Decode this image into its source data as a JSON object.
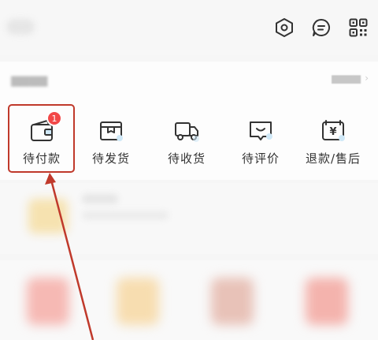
{
  "header": {
    "icons": [
      "settings-icon",
      "message-icon",
      "qrcode-icon"
    ]
  },
  "orders": {
    "items": [
      {
        "label": "待付款",
        "icon": "wallet-icon",
        "badge": "1"
      },
      {
        "label": "待发货",
        "icon": "box-icon"
      },
      {
        "label": "待收货",
        "icon": "truck-icon"
      },
      {
        "label": "待评价",
        "icon": "review-icon"
      },
      {
        "label": "退款/售后",
        "icon": "refund-icon"
      }
    ]
  },
  "colors": {
    "highlight": "#c0392b",
    "badge": "#f24848",
    "accent": "#6fb7e6"
  }
}
